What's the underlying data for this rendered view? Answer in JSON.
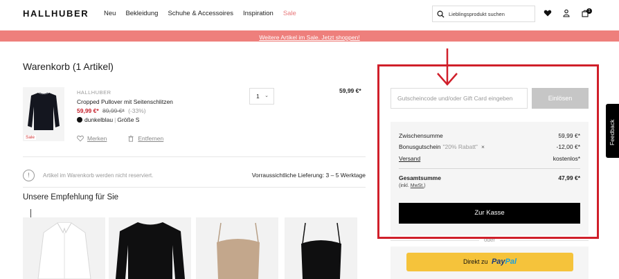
{
  "header": {
    "logo": "HALLHUBER",
    "nav": [
      "Neu",
      "Bekleidung",
      "Schuhe & Accessoires",
      "Inspiration",
      "Sale"
    ],
    "search_placeholder": "Lieblingsprodukt suchen",
    "cart_count": "1"
  },
  "promo": {
    "text": "Weitere Artikel im Sale. Jetzt shoppen!"
  },
  "cart": {
    "title": "Warenkorb (1 Artikel)",
    "item": {
      "brand": "HALLHUBER",
      "name": "Cropped Pullover mit Seitenschlitzen",
      "price_new": "59,99 €*",
      "price_old": "89,99 €*",
      "discount": "(-33%)",
      "color": "dunkelblau",
      "size": "Größe S",
      "badge": "Sale",
      "quantity": "1",
      "total": "59,99 €*",
      "action_save": "Merken",
      "action_remove": "Entfernen"
    },
    "info_text": "Artikel im Warenkorb werden nicht reserviert.",
    "delivery": "Vorraussichtliche Lieferung: 3 – 5 Werktage",
    "reco_title": "Unsere Empfehlung für Sie"
  },
  "summary": {
    "gift_placeholder": "Gutscheincode und/oder Gift Card eingeben",
    "redeem_label": "Einlösen",
    "subtotal_label": "Zwischensumme",
    "subtotal": "59,99 €*",
    "coupon_label": "Bonusgutschein",
    "coupon_note": "\"20% Rabatt\"",
    "coupon_remove": "×",
    "coupon_value": "-12,00 €*",
    "shipping_label": "Versand",
    "shipping_value": "kostenlos*",
    "total_label": "Gesamtsumme",
    "total_value": "47,99 €*",
    "incl_prefix": "(inkl.",
    "incl_link": "MwSt.",
    "incl_suffix": ")",
    "checkout_label": "Zur Kasse",
    "or_label": "oder",
    "paypal_prefix": "Direkt zu",
    "paypal_brand_1": "Pay",
    "paypal_brand_2": "Pal"
  },
  "feedback_label": "Feedback",
  "colors": {
    "accent_sale": "#c5202b",
    "promo_bg": "#ee7f7c",
    "annotation": "#d01f2a",
    "paypal": "#f5c33b"
  }
}
